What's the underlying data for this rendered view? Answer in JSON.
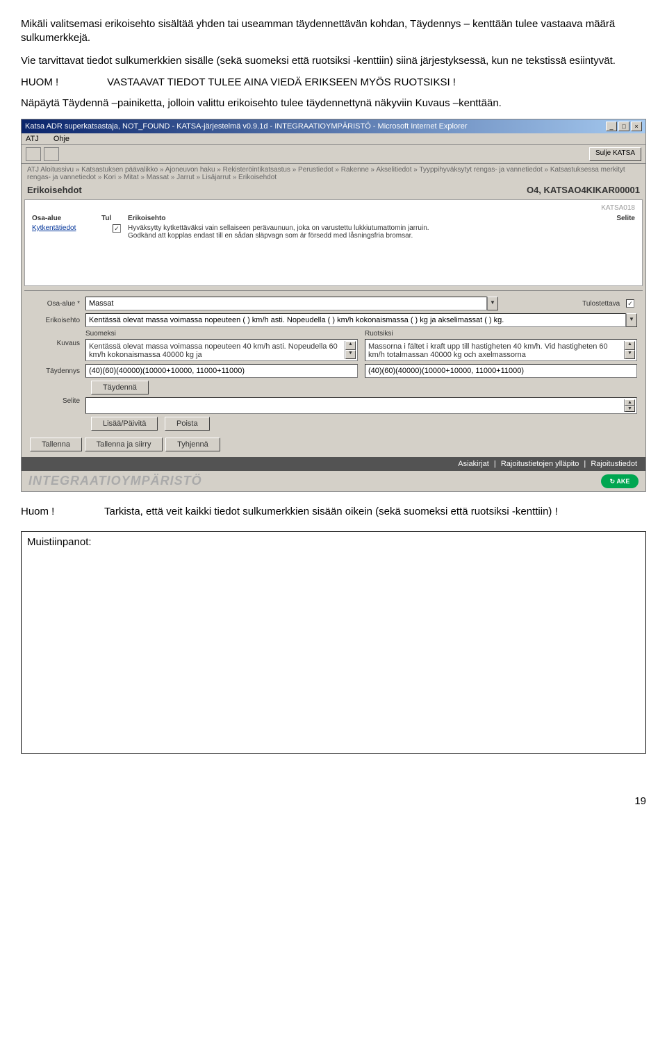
{
  "doc": {
    "p1": "Mikäli valitsemasi erikoisehto sisältää yhden tai useamman täydennettävän kohdan, Täydennys – kenttään tulee vastaava määrä sulkumerkkejä.",
    "p2": "Vie tarvittavat tiedot sulkumerkkien sisälle (sekä suomeksi että ruotsiksi -kenttiin) siinä järjestyksessä, kun ne tekstissä esiintyvät.",
    "huom_label": "HUOM !",
    "huom_text": "VASTAAVAT TIEDOT TULEE AINA VIEDÄ ERIKSEEN MYÖS RUOTSIKSI !",
    "p3": "Näpäytä Täydennä –painiketta, jolloin valittu erikoisehto tulee täydennettynä näkyviin Kuvaus –kenttään.",
    "huom2_label": "Huom !",
    "huom2_text": "Tarkista, että veit kaikki tiedot sulkumerkkien sisään oikein (sekä suomeksi että ruotsiksi -kenttiin) !",
    "muisti_label": "Muistiinpanot:",
    "pagenum": "19"
  },
  "app": {
    "title": "Katsa ADR superkatsastaja, NOT_FOUND - KATSA-järjestelmä v0.9.1d - INTEGRAATIOYMPÄRISTÖ - Microsoft Internet Explorer",
    "menu": {
      "atj": "ATJ",
      "ohje": "Ohje"
    },
    "close_katsa": "Sulje KATSA",
    "breadcrumb": "ATJ Aloitussivu » Katsastuksen päävalikko » Ajoneuvon haku » Rekisteröintikatsastus » Perustiedot » Rakenne » Akselitiedot » Tyyppihyväksytyt rengas- ja vannetiedot » Katsastuksessa merkityt rengas- ja vannetiedot » Kori » Mitat » Massat » Jarrut » Lisäjarrut » Erikoisehdot",
    "section_title": "Erikoisehdot",
    "section_right": "O4, KATSAO4KIKAR00001",
    "page_id": "KATSA018",
    "table": {
      "h_osa": "Osa-alue",
      "h_tul": "Tul",
      "h_ehto": "Erikoisehto",
      "h_sel": "Selite",
      "row": {
        "osa": "Kytkentätiedot",
        "ehto_fi": "Hyväksytty kytkettäväksi vain sellaiseen perävaunuun, joka on varustettu lukkiutumattomin jarruin.",
        "ehto_sv": "Godkänd att kopplas endast till en sådan släpvagn som är försedd med låsningsfria bromsar."
      }
    },
    "form": {
      "osa_label": "Osa-alue *",
      "osa_value": "Massat",
      "tulo_label": "Tulostettava",
      "erikois_label": "Erikoisehto",
      "erikois_value": "Kentässä olevat massa voimassa nopeuteen ( ) km/h asti. Nopeudella ( ) km/h kokonaismassa ( ) kg ja akselimassat ( ) kg.",
      "kuvaus_label": "Kuvaus",
      "suomeksi": "Suomeksi",
      "ruotsiksi": "Ruotsiksi",
      "kuvaus_fi": "Kentässä olevat massa voimassa nopeuteen 40 km/h asti. Nopeudella 60 km/h kokonaismassa 40000 kg ja",
      "kuvaus_sv": "Massorna i fältet i kraft upp till hastigheten 40 km/h. Vid hastigheten 60 km/h totalmassan 40000 kg och axelmassorna",
      "tayden_label": "Täydennys",
      "tayden_fi": "(40)(60)(40000)(10000+10000, 11000+11000)",
      "tayden_sv": "(40)(60)(40000)(10000+10000, 11000+11000)",
      "btn_taydenna": "Täydennä",
      "selite_label": "Selite",
      "btn_lisaa": "Lisää/Päivitä",
      "btn_poista": "Poista",
      "btn_tallenna": "Tallenna",
      "btn_tallenna_siirry": "Tallenna ja siirry",
      "btn_tyhjenna": "Tyhjennä"
    },
    "bottom": {
      "asiakirjat": "Asiakirjat",
      "rajoitus_yp": "Rajoitustietojen ylläpito",
      "rajoitustiedot": "Rajoitustiedot"
    },
    "env": "INTEGRAATIOYMPÄRISTÖ",
    "ake": "AKE"
  }
}
